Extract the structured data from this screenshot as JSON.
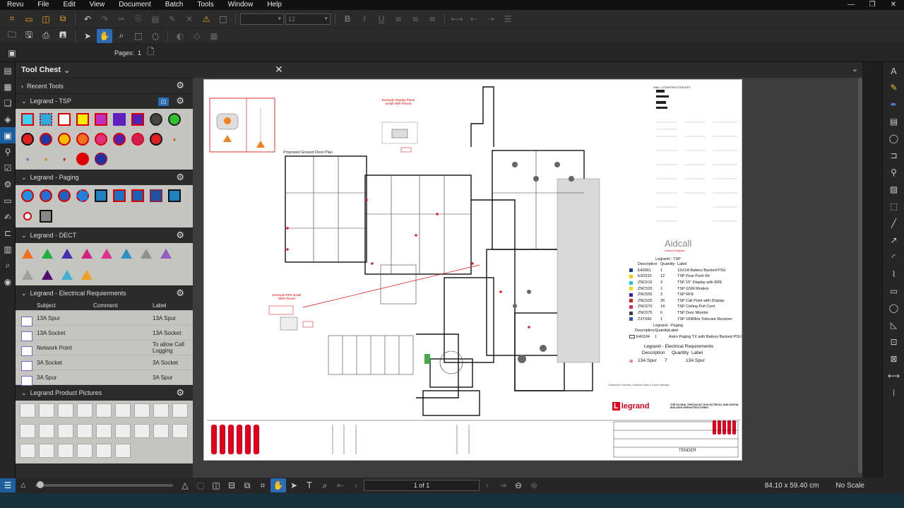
{
  "menu": [
    "Revu",
    "File",
    "Edit",
    "View",
    "Document",
    "Batch",
    "Tools",
    "Window",
    "Help"
  ],
  "window_controls": [
    "—",
    "❐",
    "✕"
  ],
  "toolbar": {
    "pages_label": "Pages:",
    "pages_value": "1",
    "font_size": "12"
  },
  "tool_chest": {
    "title": "Tool Chest",
    "recent": "Recent Tools",
    "sections": {
      "tsp": "Legrand - TSP",
      "paging": "Legrand - Paging",
      "dect": "Legrand - DECT",
      "electrical": "Legrand - Electrical Requierments",
      "pictures": "Legrand Product Pictures"
    },
    "table_headers": [
      "Subject",
      "Comment",
      "Label"
    ],
    "electrical_rows": [
      {
        "subject": "13A Spur",
        "comment": "",
        "label": "13A Spur"
      },
      {
        "subject": "13A Socket",
        "comment": "",
        "label": "13A Socket"
      },
      {
        "subject": "Network Point",
        "comment": "",
        "label": "To allow Call Logging"
      },
      {
        "subject": "3A Socket",
        "comment": "",
        "label": "3A Socket"
      },
      {
        "subject": "3A Spur",
        "comment": "",
        "label": "3A Spur"
      }
    ]
  },
  "status": {
    "page": "1 of 1",
    "dimensions": "84.10 x 59.40 cm",
    "scale": "No Scale"
  },
  "sheet": {
    "plan_title": "Proposed Ground Floor Plan",
    "display_note": "Example Display Panel install With Flexed",
    "wire_note": "Example RFE install With Flexed",
    "wall_key": "WALL CONSTRUCTION KEY",
    "brand_aidcall": "Aidcall",
    "brand_tagline": "a brand of legrand",
    "legend_tsp_title": "Legrand - TSP",
    "legend_cols": [
      "Description",
      "Quantity",
      "Label"
    ],
    "tsp_rows": [
      {
        "desc": "E40061",
        "qty": "1",
        "label": "12v/1A Battery Backed PSU",
        "color": "#1a3aa8"
      },
      {
        "desc": "ES0310",
        "qty": "12",
        "label": "TSP Pear Push Kit",
        "color": "#f0d000"
      },
      {
        "desc": "ZNC516",
        "qty": "3",
        "label": "TSP 15\" Display with RFE",
        "color": "#20c0e0"
      },
      {
        "desc": "ZNC520",
        "qty": "1",
        "label": "TSP GSM Modem",
        "color": "#e8e000"
      },
      {
        "desc": "ZNC555",
        "qty": "3",
        "label": "TSP RFE",
        "color": "#4020a0"
      },
      {
        "desc": "ZNC625",
        "qty": "26",
        "label": "TSP Call Point with Display",
        "color": "#e02020"
      },
      {
        "desc": "ZNC670",
        "qty": "14",
        "label": "TSP Ceiling Pull Cord",
        "color": "#d03060"
      },
      {
        "desc": "ZNC675",
        "qty": "6",
        "label": "TSP Door Monitor",
        "color": "#404040"
      },
      {
        "desc": "ZXT660",
        "qty": "1",
        "label": "TSP 169MHz Telecare Receiver",
        "color": "#3050c0"
      }
    ],
    "legend_paging_title": "Legrand - Paging",
    "paging_rows": [
      {
        "desc": "E40104",
        "qty": "1",
        "label": "Astro Paging TX with Battery Backed PSU"
      }
    ],
    "legend_elec_title": "Legrand - Electrical Requirements",
    "elec_rows": [
      {
        "desc": "13A Spur",
        "qty": "7",
        "label": "13A Spur"
      }
    ],
    "contact_name": "Christopher Donnelly | National Sales & Export Manager",
    "legrand": "legrand",
    "legrand_tagline": "THE GLOBAL SPECIALIST IN ELECTRICAL AND DIGITAL BUILDING INFRASTRUCTURES",
    "tender": "TENDER"
  },
  "colors": {
    "accent": "#2a6db5",
    "tool_orange": "#f2a01c",
    "legrand_red": "#e2001a"
  }
}
